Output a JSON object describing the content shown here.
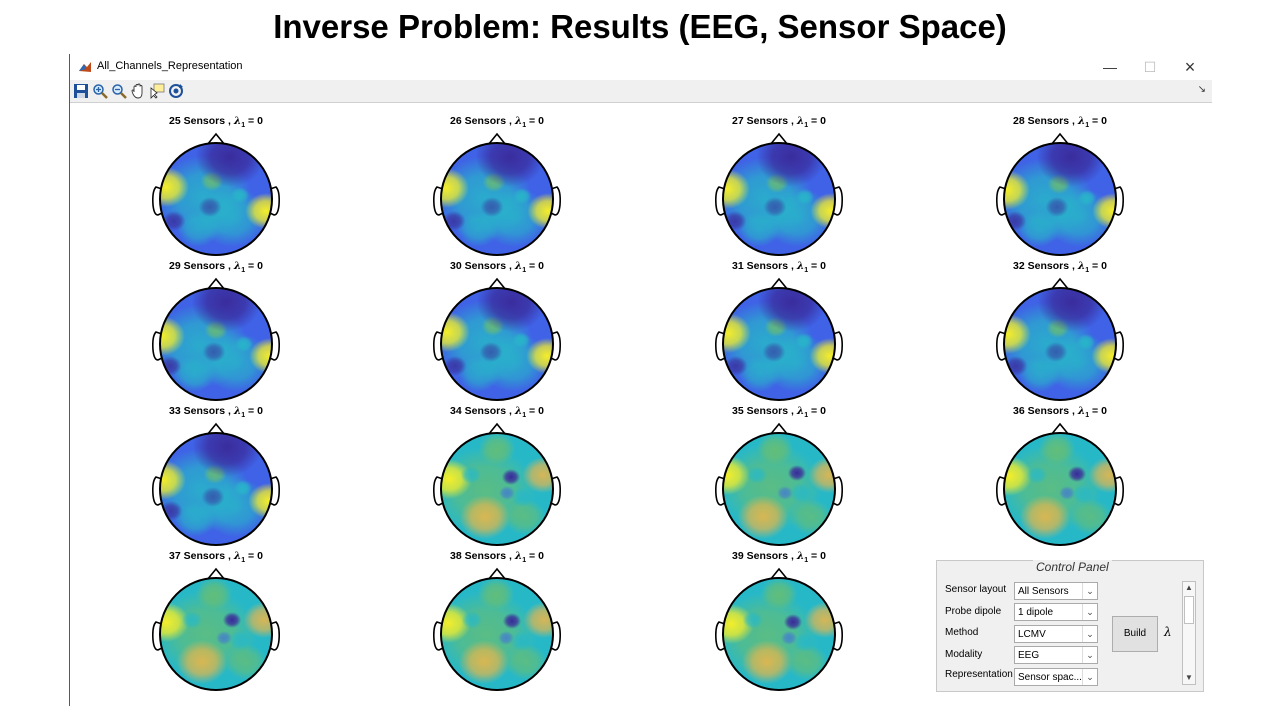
{
  "slide_title": "Inverse Problem: Results (EEG, Sensor Space)",
  "window": {
    "title": "All_Channels_Representation",
    "minimize_icon": "minimize-icon",
    "maximize_icon": "maximize-icon",
    "close_icon": "close-icon"
  },
  "toolbar": {
    "icons": [
      "save-icon",
      "zoom-in-icon",
      "zoom-out-icon",
      "pan-icon",
      "data-cursor-icon",
      "rotate-icon"
    ]
  },
  "topoplots": [
    {
      "sensors": "25 Sensors",
      "pattern": "blue"
    },
    {
      "sensors": "26 Sensors",
      "pattern": "blue"
    },
    {
      "sensors": "27 Sensors",
      "pattern": "blue"
    },
    {
      "sensors": "28 Sensors",
      "pattern": "blue"
    },
    {
      "sensors": "29 Sensors",
      "pattern": "blue"
    },
    {
      "sensors": "30 Sensors",
      "pattern": "blue"
    },
    {
      "sensors": "31 Sensors",
      "pattern": "blue"
    },
    {
      "sensors": "32 Sensors",
      "pattern": "blue"
    },
    {
      "sensors": "33 Sensors",
      "pattern": "blue"
    },
    {
      "sensors": "34 Sensors",
      "pattern": "green"
    },
    {
      "sensors": "35 Sensors",
      "pattern": "green"
    },
    {
      "sensors": "36 Sensors",
      "pattern": "green"
    },
    {
      "sensors": "37 Sensors",
      "pattern": "green"
    },
    {
      "sensors": "38 Sensors",
      "pattern": "green"
    },
    {
      "sensors": "39 Sensors",
      "pattern": "green"
    }
  ],
  "lambda_label": "λ",
  "lambda_subscript": "1",
  "lambda_value": "= 0",
  "colors": {
    "dark_blue": "#3a2a9a",
    "blue": "#3f62e6",
    "cyan": "#27b8c8",
    "green": "#6fbf68",
    "yellow": "#f4ee2a",
    "orange": "#e9b64a"
  },
  "control_panel": {
    "title": "Control Panel",
    "rows": [
      {
        "label": "Sensor layout",
        "value": "All Sensors"
      },
      {
        "label": "Probe dipole",
        "value": "1 dipole"
      },
      {
        "label": "Method",
        "value": "LCMV"
      },
      {
        "label": "Modality",
        "value": "EEG"
      },
      {
        "label": "Representation",
        "value": "Sensor spac..."
      }
    ],
    "build_label": "Build",
    "lambda_symbol": "λ"
  }
}
